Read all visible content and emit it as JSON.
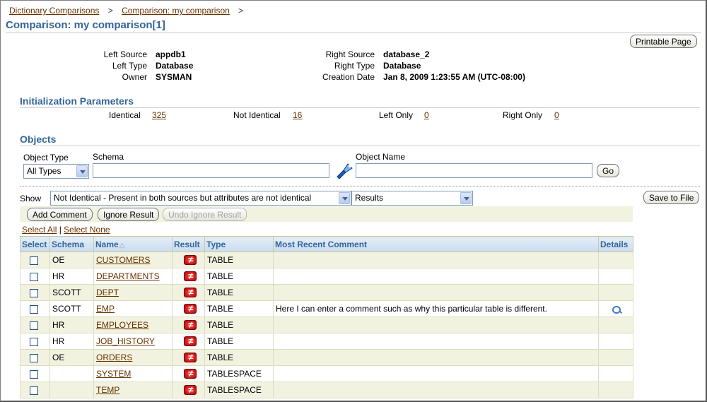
{
  "breadcrumb": {
    "item1": "Dictionary Comparisons",
    "sep": ">",
    "item2": "Comparison: my comparison"
  },
  "page_title": "Comparison: my comparison[1]",
  "buttons": {
    "printable": "Printable Page",
    "go": "Go",
    "save_to_file": "Save to File",
    "add_comment": "Add Comment",
    "ignore_result": "Ignore Result",
    "undo_ignore": "Undo Ignore Result"
  },
  "info": {
    "left_source_label": "Left Source",
    "left_source_value": "appdb1",
    "left_type_label": "Left Type",
    "left_type_value": "Database",
    "owner_label": "Owner",
    "owner_value": "SYSMAN",
    "right_source_label": "Right Source",
    "right_source_value": "database_2",
    "right_type_label": "Right Type",
    "right_type_value": "Database",
    "creation_date_label": "Creation Date",
    "creation_date_value": "Jan 8, 2009 1:23:55 AM (UTC-08:00)"
  },
  "init_params": {
    "header": "Initialization Parameters",
    "identical_label": "Identical",
    "identical_value": "325",
    "not_identical_label": "Not Identical",
    "not_identical_value": "16",
    "left_only_label": "Left Only",
    "left_only_value": "0",
    "right_only_label": "Right Only",
    "right_only_value": "0"
  },
  "objects": {
    "header": "Objects",
    "object_type_label": "Object Type",
    "object_type_value": "All Types",
    "schema_label": "Schema",
    "schema_value": "",
    "object_name_label": "Object Name",
    "object_name_value": ""
  },
  "show": {
    "label": "Show",
    "filter_value": "Not Identical - Present in both sources but attributes are not identical",
    "view_value": "Results"
  },
  "selection": {
    "select_all": "Select All",
    "divider": "|",
    "select_none": "Select None"
  },
  "table": {
    "headers": {
      "select": "Select",
      "schema": "Schema",
      "name": "Name",
      "name_sort": "△",
      "result": "Result",
      "type": "Type",
      "comment": "Most Recent Comment",
      "details": "Details"
    },
    "rows": [
      {
        "schema": "OE",
        "name": "CUSTOMERS",
        "type": "TABLE",
        "comment": ""
      },
      {
        "schema": "HR",
        "name": "DEPARTMENTS",
        "type": "TABLE",
        "comment": ""
      },
      {
        "schema": "SCOTT",
        "name": "DEPT",
        "type": "TABLE",
        "comment": ""
      },
      {
        "schema": "SCOTT",
        "name": "EMP",
        "type": "TABLE",
        "comment": "Here I can enter a comment such as why this particular table is different."
      },
      {
        "schema": "HR",
        "name": "EMPLOYEES",
        "type": "TABLE",
        "comment": ""
      },
      {
        "schema": "HR",
        "name": "JOB_HISTORY",
        "type": "TABLE",
        "comment": ""
      },
      {
        "schema": "OE",
        "name": "ORDERS",
        "type": "TABLE",
        "comment": ""
      },
      {
        "schema": "",
        "name": "SYSTEM",
        "type": "TABLESPACE",
        "comment": ""
      },
      {
        "schema": "",
        "name": "TEMP",
        "type": "TABLESPACE",
        "comment": ""
      }
    ]
  },
  "colors": {
    "header_blue": "#336699",
    "link_brown": "#663300",
    "band_beige": "#f2f2e0"
  }
}
